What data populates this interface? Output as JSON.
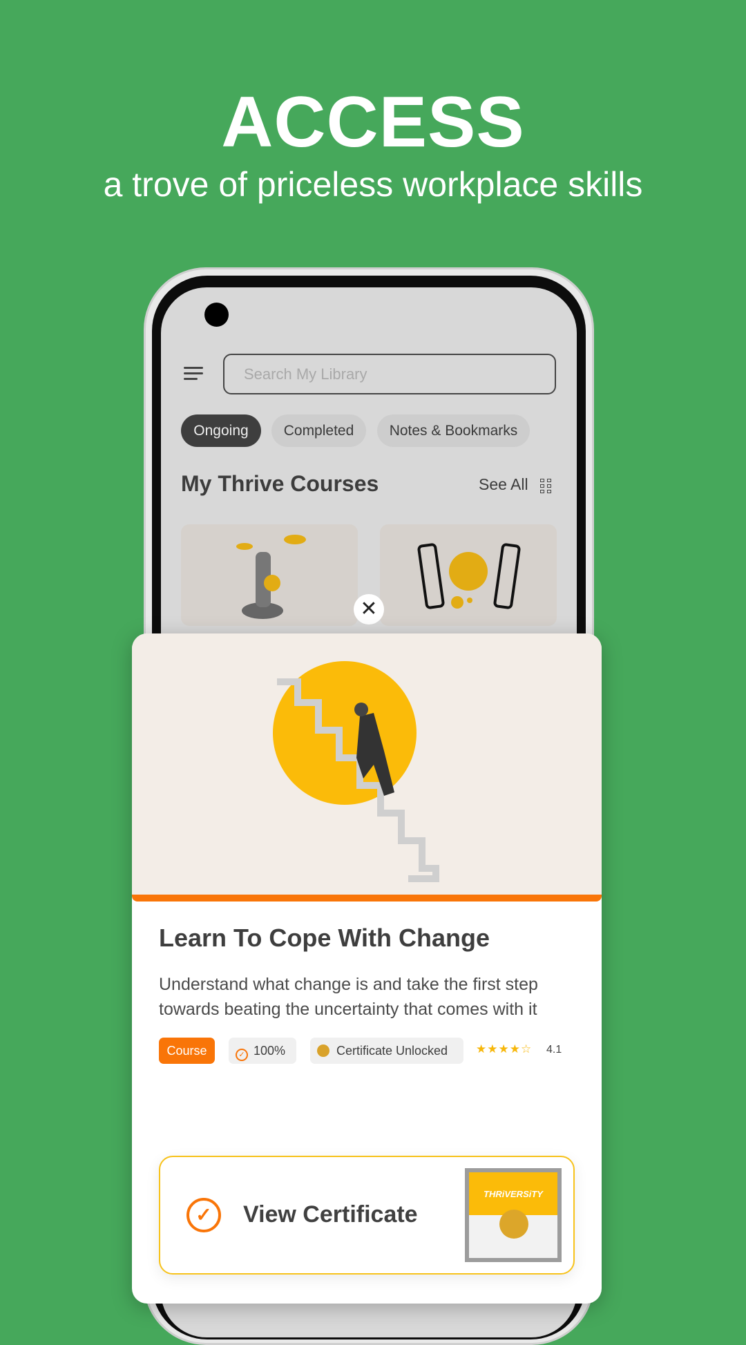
{
  "promo": {
    "headline": "ACCESS",
    "subtitle": "a trove of priceless workplace skills"
  },
  "library": {
    "search_placeholder": "Search My Library",
    "tabs": [
      {
        "label": "Ongoing",
        "active": true
      },
      {
        "label": "Completed",
        "active": false
      },
      {
        "label": "Notes & Bookmarks",
        "active": false
      }
    ],
    "section_title": "My Thrive Courses",
    "see_all": "See All"
  },
  "modal": {
    "title": "Learn To Cope With Change",
    "description": "Understand what change is and take the first step towards beating the uncertainty that comes with it",
    "badges": {
      "type": "Course",
      "progress": "100%",
      "certificate": "Certificate Unlocked"
    },
    "rating": {
      "value": "4.1",
      "stars": 4,
      "max": 5
    },
    "cta": "View Certificate",
    "certificate_brand": "THRiVERSiTY"
  },
  "colors": {
    "background": "#46a85b",
    "accent": "#f97508",
    "yellow": "#fbbb09"
  }
}
